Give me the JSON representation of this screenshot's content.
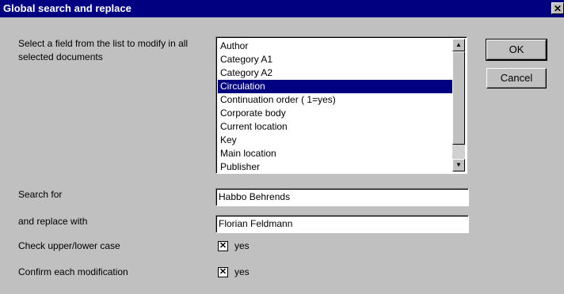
{
  "window": {
    "title": "Global search and replace",
    "close_glyph": "✕"
  },
  "field_list": {
    "prompt": "Select a field from the list to modify in all selected documents",
    "items": [
      "Author",
      "Category A1",
      "Category A2",
      "Circulation",
      "Continuation order ( 1=yes)",
      "Corporate body",
      "Current location",
      "Key",
      "Main location",
      "Publisher"
    ],
    "selected": "Circulation"
  },
  "buttons": {
    "ok": "OK",
    "cancel": "Cancel"
  },
  "search": {
    "label": "Search for",
    "value": "Habbo Behrends"
  },
  "replace": {
    "label": "and replace with",
    "value": "Florian Feldmann"
  },
  "case_check": {
    "label": "Check upper/lower case",
    "checked": true,
    "option": "yes"
  },
  "confirm_check": {
    "label": "Confirm each modification",
    "checked": true,
    "option": "yes"
  },
  "icons": {
    "checkmark": "✕",
    "scroll_up": "▲",
    "scroll_down": "▼"
  }
}
